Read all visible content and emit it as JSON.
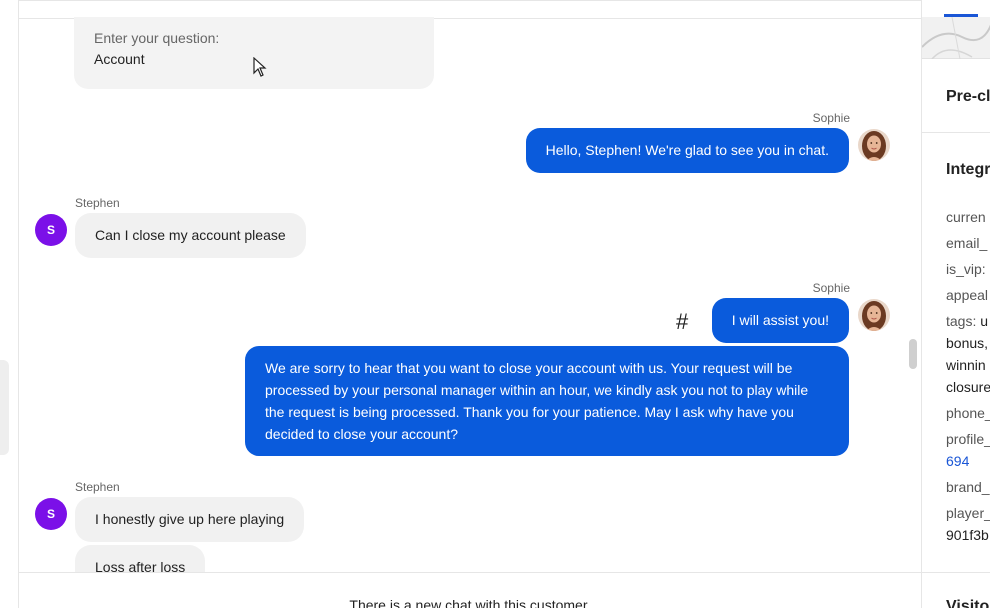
{
  "form": {
    "label": "Enter your question:",
    "value": "Account"
  },
  "messages": [
    {
      "sender": "Sophie",
      "text": "Hello, Stephen! We're glad to see you in chat."
    },
    {
      "sender": "Stephen",
      "avatar": "S",
      "text": "Can I close my account please"
    },
    {
      "sender": "Sophie",
      "text": "I will assist you!",
      "marker": "#"
    },
    {
      "text": "We are sorry to hear that you want to close your account with us. Your request will be processed by your personal manager within an hour, we kindly ask you not to play while the request is being processed. Thank you for your patience. May I ask why have you decided to close your account?"
    },
    {
      "sender": "Stephen",
      "avatar": "S",
      "text": "I honestly give up here playing"
    },
    {
      "text": "Loss after loss"
    }
  ],
  "footer": {
    "notice": "There is a new chat with this customer."
  },
  "sidebar": {
    "pre_chat_title": "Pre-cl",
    "integration_title": "Integr",
    "rows": {
      "currency": "curren",
      "email": "email_",
      "is_vip": "is_vip:",
      "appeal": "appeal",
      "tags_label": "tags:",
      "tags_value_1": "u",
      "tags_value_2": "bonus,",
      "tags_value_3": "winnin",
      "tags_value_4": "closure",
      "phone": "phone_",
      "profile": "profile_",
      "profile_value": "694",
      "brand": "brand_",
      "player": "player_",
      "player_value": "901f3b"
    },
    "visitor_title": "Visito"
  },
  "colors": {
    "agent_bubble": "#0a5bdc",
    "customer_bubble": "#f1f1f1",
    "customer_avatar": "#7b10e8",
    "link": "#1a56d6"
  }
}
